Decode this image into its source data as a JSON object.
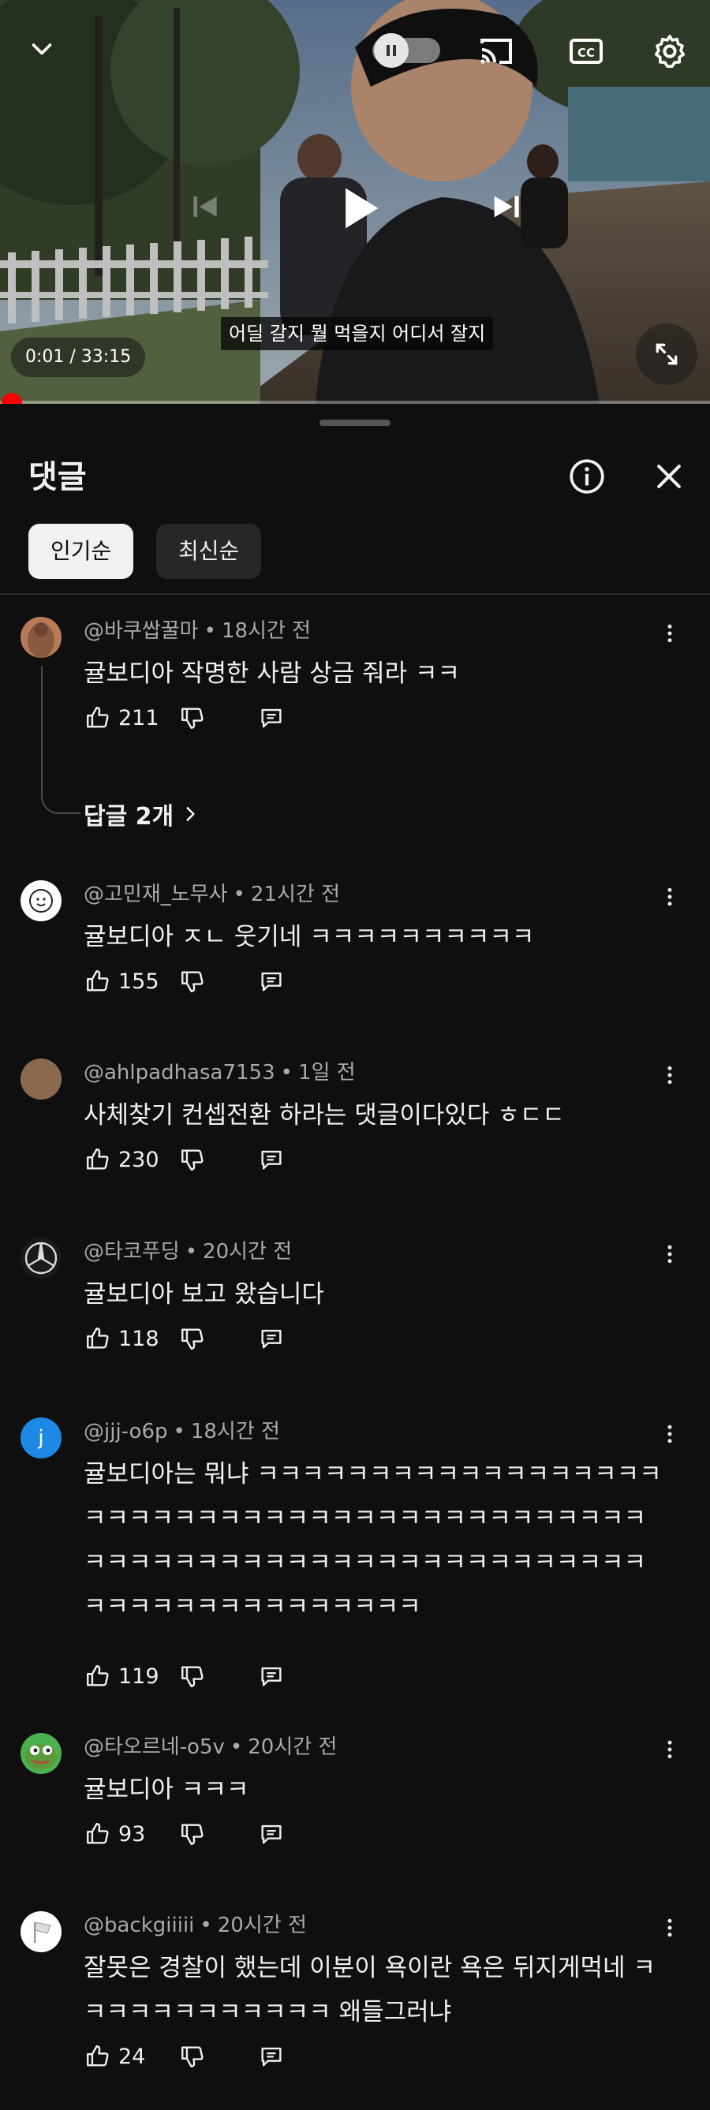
{
  "player": {
    "subtitle": "어딜 갈지 뭘 먹을지 어디서 잘지",
    "time": "0:01 / 33:15",
    "progress": 0.0005,
    "autoplay_on": false
  },
  "comments_panel": {
    "title": "댓글",
    "sort_chips": [
      "인기순",
      "최신순"
    ],
    "active_sort": "인기순"
  },
  "comments": [
    {
      "author": "@바쿠쌉꿀마",
      "time": "18시간 전",
      "text": "귤보디아 작명한 사람 상금 줘라 ㅋㅋ",
      "likes": "211",
      "replies": "답글 2개",
      "avatar_color": "#b97a5a"
    },
    {
      "author": "@고민재_노무사",
      "time": "21시간 전",
      "text": "귤보디아 ㅈㄴ 웃기네 ㅋㅋㅋㅋㅋㅋㅋㅋㅋㅋ",
      "likes": "155",
      "avatar_color": "#ffffff"
    },
    {
      "author": "@ahlpadhasa7153",
      "time": "1일 전",
      "text": "사체찾기 컨셉전환 하라는 댓글이다있다 ㅎㄷㄷ",
      "likes": "230",
      "avatar_color": "#8a6a4f"
    },
    {
      "author": "@타코푸딩",
      "time": "20시간 전",
      "text": "귤보디아 보고 왔습니다",
      "likes": "118",
      "avatar_color": "#1a1a1a"
    },
    {
      "author": "@jjj-o6p",
      "time": "18시간 전",
      "text": "귤보디아는 뭐냐 ㅋㅋㅋㅋㅋㅋㅋㅋㅋㅋㅋㅋㅋㅋㅋㅋㅋㅋㅋㅋㅋㅋㅋㅋㅋㅋㅋㅋㅋㅋㅋㅋㅋㅋㅋㅋㅋㅋㅋㅋㅋㅋㅋㅋㅋㅋㅋㅋㅋㅋㅋㅋㅋㅋㅋㅋㅋㅋㅋㅋㅋㅋㅋㅋㅋㅋㅋㅋㅋㅋㅋㅋㅋㅋㅋㅋㅋㅋㅋㅋㅋㅋㅋ",
      "likes": "119",
      "avatar_letter": "j",
      "avatar_color": "#1e88e5"
    },
    {
      "author": "@타오르네-o5v",
      "time": "20시간 전",
      "text": "귤보디아 ㅋㅋㅋ",
      "likes": "93",
      "avatar_color": "#4caf50"
    },
    {
      "author": "@backgiiiii",
      "time": "20시간 전",
      "text": "잘못은 경찰이 했는데 이분이 욕이란 욕은 뒤지게먹네 ㅋㅋㅋㅋㅋㅋㅋㅋㅋㅋㅋㅋ 왜들그러냐",
      "likes": "24",
      "avatar_color": "#ffffff"
    }
  ],
  "separator": "•",
  "colors": {
    "accent": "#ff0000",
    "background": "#0f0f0f",
    "secondary_text": "#aaaaaa",
    "link": "#3ea6ff"
  },
  "icons": [
    "chevron-down-icon",
    "pause-icon",
    "cast-icon",
    "captions-icon",
    "settings-icon",
    "previous-icon",
    "play-icon",
    "next-icon",
    "fullscreen-icon",
    "info-icon",
    "close-icon",
    "thumb-up-icon",
    "thumb-down-icon",
    "reply-icon",
    "more-vert-icon",
    "chevron-right-icon"
  ]
}
